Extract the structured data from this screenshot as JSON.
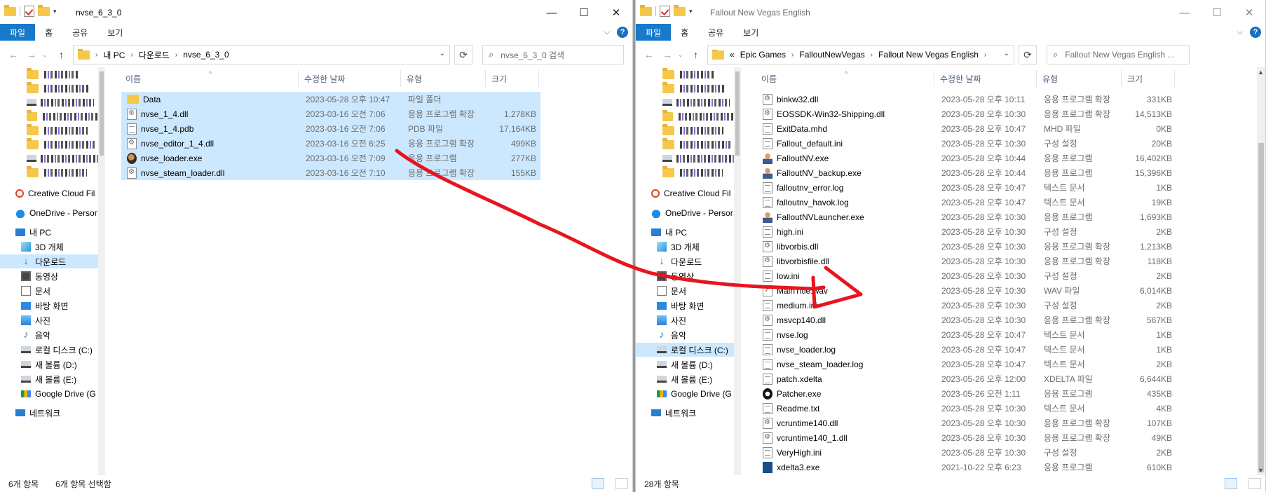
{
  "left": {
    "title": "nvse_6_3_0",
    "ribbon": [
      "파일",
      "홈",
      "공유",
      "보기"
    ],
    "breadcrumb": [
      "내 PC",
      "다운로드",
      "nvse_6_3_0"
    ],
    "search_placeholder": "nvse_6_3_0 검색",
    "columns": [
      "이름",
      "수정한 날짜",
      "유형",
      "크기"
    ],
    "nav": [
      {
        "label": "",
        "icon": "folder",
        "blurred": true
      },
      {
        "label": "",
        "icon": "folder",
        "blurred": true
      },
      {
        "label": "",
        "icon": "drive",
        "blurred": true
      },
      {
        "label": "",
        "icon": "folder",
        "blurred": true
      },
      {
        "label": "",
        "icon": "folder",
        "blurred": true
      },
      {
        "label": "",
        "icon": "folder",
        "blurred": true
      },
      {
        "label": "",
        "icon": "drive",
        "blurred": true
      },
      {
        "label": "",
        "icon": "folder",
        "blurred": true
      },
      {
        "label": "Creative Cloud Fil",
        "icon": "cc"
      },
      {
        "label": "OneDrive - Persor",
        "icon": "cloud"
      },
      {
        "label": "내 PC",
        "icon": "pc"
      },
      {
        "label": "3D 개체",
        "icon": "cube"
      },
      {
        "label": "다운로드",
        "icon": "down",
        "selected": true
      },
      {
        "label": "동영상",
        "icon": "video"
      },
      {
        "label": "문서",
        "icon": "doc"
      },
      {
        "label": "바탕 화면",
        "icon": "desk"
      },
      {
        "label": "사진",
        "icon": "pic"
      },
      {
        "label": "음악",
        "icon": "music"
      },
      {
        "label": "로컬 디스크 (C:)",
        "icon": "drive"
      },
      {
        "label": "새 볼륨 (D:)",
        "icon": "drive"
      },
      {
        "label": "새 볼륨 (E:)",
        "icon": "drive"
      },
      {
        "label": "Google Drive (G",
        "icon": "gd"
      },
      {
        "label": "네트워크",
        "icon": "net"
      }
    ],
    "files": [
      {
        "name": "Data",
        "date": "2023-05-28 오후 10:47",
        "type": "파일 폴더",
        "size": "",
        "icon": "folder"
      },
      {
        "name": "nvse_1_4.dll",
        "date": "2023-03-16 오전 7:06",
        "type": "응용 프로그램 확장",
        "size": "1,278KB",
        "icon": "dll"
      },
      {
        "name": "nvse_1_4.pdb",
        "date": "2023-03-16 오전 7:06",
        "type": "PDB 파일",
        "size": "17,164KB",
        "icon": "txt"
      },
      {
        "name": "nvse_editor_1_4.dll",
        "date": "2023-03-16 오전 6:25",
        "type": "응용 프로그램 확장",
        "size": "499KB",
        "icon": "dll"
      },
      {
        "name": "nvse_loader.exe",
        "date": "2023-03-16 오전 7:09",
        "type": "응용 프로그램",
        "size": "277KB",
        "icon": "exe"
      },
      {
        "name": "nvse_steam_loader.dll",
        "date": "2023-03-16 오전 7:10",
        "type": "응용 프로그램 확장",
        "size": "155KB",
        "icon": "dll"
      }
    ],
    "status_count": "6개 항목",
    "status_selected": "6개 항목 선택함"
  },
  "right": {
    "title": "Fallout New Vegas English",
    "ribbon": [
      "파일",
      "홈",
      "공유",
      "보기"
    ],
    "breadcrumb_prefix": "«",
    "breadcrumb": [
      "Epic Games",
      "FalloutNewVegas",
      "Fallout New Vegas English"
    ],
    "search_placeholder": "Fallout New Vegas English ...",
    "columns": [
      "이름",
      "수정한 날짜",
      "유형",
      "크기"
    ],
    "nav": [
      {
        "label": "",
        "icon": "folder",
        "blurred": true
      },
      {
        "label": "",
        "icon": "folder",
        "blurred": true
      },
      {
        "label": "",
        "icon": "drive",
        "blurred": true
      },
      {
        "label": "",
        "icon": "folder",
        "blurred": true
      },
      {
        "label": "",
        "icon": "folder",
        "blurred": true
      },
      {
        "label": "",
        "icon": "folder",
        "blurred": true
      },
      {
        "label": "",
        "icon": "drive",
        "blurred": true
      },
      {
        "label": "",
        "icon": "folder",
        "blurred": true
      },
      {
        "label": "Creative Cloud Fil",
        "icon": "cc"
      },
      {
        "label": "OneDrive - Persor",
        "icon": "cloud"
      },
      {
        "label": "내 PC",
        "icon": "pc"
      },
      {
        "label": "3D 개체",
        "icon": "cube"
      },
      {
        "label": "다운로드",
        "icon": "down"
      },
      {
        "label": "동영상",
        "icon": "video"
      },
      {
        "label": "문서",
        "icon": "doc"
      },
      {
        "label": "바탕 화면",
        "icon": "desk"
      },
      {
        "label": "사진",
        "icon": "pic"
      },
      {
        "label": "음악",
        "icon": "music"
      },
      {
        "label": "로컬 디스크 (C:)",
        "icon": "drive",
        "selected": true
      },
      {
        "label": "새 볼륨 (D:)",
        "icon": "drive"
      },
      {
        "label": "새 볼륨 (E:)",
        "icon": "drive"
      },
      {
        "label": "Google Drive (G",
        "icon": "gd"
      },
      {
        "label": "네트워크",
        "icon": "net"
      }
    ],
    "files": [
      {
        "name": "binkw32.dll",
        "date": "2023-05-28 오후 10:11",
        "type": "응용 프로그램 확장",
        "size": "331KB",
        "icon": "dll"
      },
      {
        "name": "EOSSDK-Win32-Shipping.dll",
        "date": "2023-05-28 오후 10:30",
        "type": "응용 프로그램 확장",
        "size": "14,513KB",
        "icon": "dll"
      },
      {
        "name": "ExitData.mhd",
        "date": "2023-05-28 오후 10:47",
        "type": "MHD 파일",
        "size": "0KB",
        "icon": "txt"
      },
      {
        "name": "Fallout_default.ini",
        "date": "2023-05-28 오후 10:30",
        "type": "구성 설정",
        "size": "20KB",
        "icon": "ini"
      },
      {
        "name": "FalloutNV.exe",
        "date": "2023-05-28 오후 10:44",
        "type": "응용 프로그램",
        "size": "16,402KB",
        "icon": "fnv"
      },
      {
        "name": "FalloutNV_backup.exe",
        "date": "2023-05-28 오후 10:44",
        "type": "응용 프로그램",
        "size": "15,396KB",
        "icon": "fnv"
      },
      {
        "name": "falloutnv_error.log",
        "date": "2023-05-28 오후 10:47",
        "type": "텍스트 문서",
        "size": "1KB",
        "icon": "txt"
      },
      {
        "name": "falloutnv_havok.log",
        "date": "2023-05-28 오후 10:47",
        "type": "텍스트 문서",
        "size": "19KB",
        "icon": "txt"
      },
      {
        "name": "FalloutNVLauncher.exe",
        "date": "2023-05-28 오후 10:30",
        "type": "응용 프로그램",
        "size": "1,693KB",
        "icon": "fnv"
      },
      {
        "name": "high.ini",
        "date": "2023-05-28 오후 10:30",
        "type": "구성 설정",
        "size": "2KB",
        "icon": "ini"
      },
      {
        "name": "libvorbis.dll",
        "date": "2023-05-28 오후 10:30",
        "type": "응용 프로그램 확장",
        "size": "1,213KB",
        "icon": "dll"
      },
      {
        "name": "libvorbisfile.dll",
        "date": "2023-05-28 오후 10:30",
        "type": "응용 프로그램 확장",
        "size": "118KB",
        "icon": "dll"
      },
      {
        "name": "low.ini",
        "date": "2023-05-28 오후 10:30",
        "type": "구성 설정",
        "size": "2KB",
        "icon": "ini"
      },
      {
        "name": "MainTitle.wav",
        "date": "2023-05-28 오후 10:30",
        "type": "WAV 파일",
        "size": "6,014KB",
        "icon": "wav"
      },
      {
        "name": "medium.ini",
        "date": "2023-05-28 오후 10:30",
        "type": "구성 설정",
        "size": "2KB",
        "icon": "ini"
      },
      {
        "name": "msvcp140.dll",
        "date": "2023-05-28 오후 10:30",
        "type": "응용 프로그램 확장",
        "size": "567KB",
        "icon": "dll"
      },
      {
        "name": "nvse.log",
        "date": "2023-05-28 오후 10:47",
        "type": "텍스트 문서",
        "size": "1KB",
        "icon": "txt"
      },
      {
        "name": "nvse_loader.log",
        "date": "2023-05-28 오후 10:47",
        "type": "텍스트 문서",
        "size": "1KB",
        "icon": "txt"
      },
      {
        "name": "nvse_steam_loader.log",
        "date": "2023-05-28 오후 10:47",
        "type": "텍스트 문서",
        "size": "2KB",
        "icon": "txt"
      },
      {
        "name": "patch.xdelta",
        "date": "2023-05-26 오후 12:00",
        "type": "XDELTA 파일",
        "size": "6,644KB",
        "icon": "txt"
      },
      {
        "name": "Patcher.exe",
        "date": "2023-05-26 오전 1:11",
        "type": "응용 프로그램",
        "size": "435KB",
        "icon": "patcher"
      },
      {
        "name": "Readme.txt",
        "date": "2023-05-28 오후 10:30",
        "type": "텍스트 문서",
        "size": "4KB",
        "icon": "txt"
      },
      {
        "name": "vcruntime140.dll",
        "date": "2023-05-28 오후 10:30",
        "type": "응용 프로그램 확장",
        "size": "107KB",
        "icon": "dll"
      },
      {
        "name": "vcruntime140_1.dll",
        "date": "2023-05-28 오후 10:30",
        "type": "응용 프로그램 확장",
        "size": "49KB",
        "icon": "dll"
      },
      {
        "name": "VeryHigh.ini",
        "date": "2023-05-28 오후 10:30",
        "type": "구성 설정",
        "size": "2KB",
        "icon": "ini"
      },
      {
        "name": "xdelta3.exe",
        "date": "2021-10-22 오후 6:23",
        "type": "응용 프로그램",
        "size": "610KB",
        "icon": "xd"
      }
    ],
    "status_count": "28개 항목"
  },
  "annotation_color": "#e8141e",
  "selection_color": "#cce8ff",
  "accent_color": "#1979ca"
}
